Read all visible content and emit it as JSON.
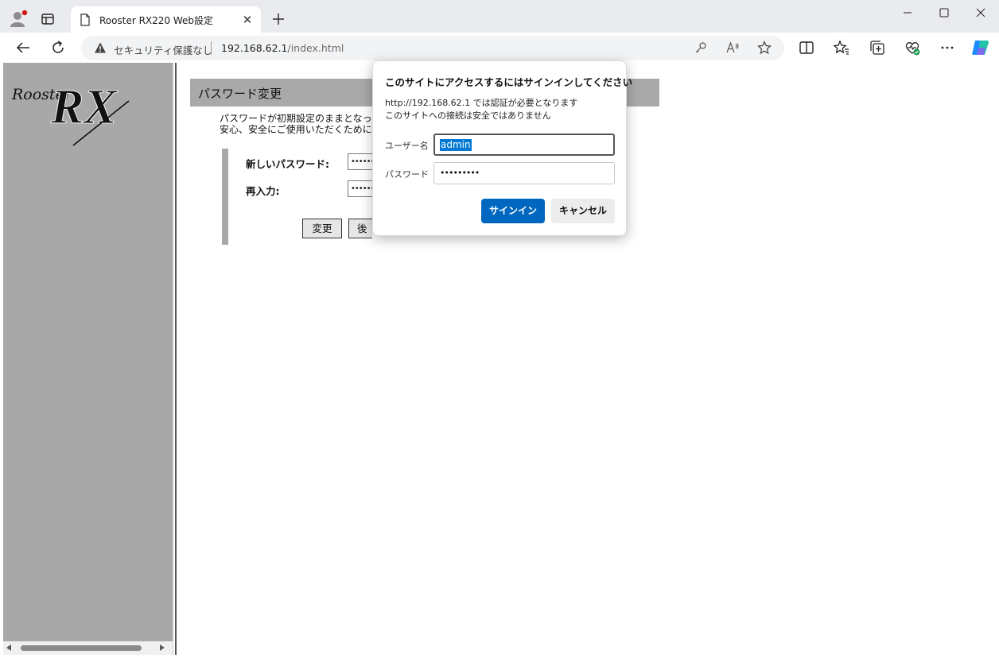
{
  "browser": {
    "tab_title": "Rooster RX220 Web設定",
    "tab_close": "✕",
    "security_label": "セキュリティ保護なし",
    "url_host": "192.168.62.1",
    "url_path": "/index.html",
    "icons": [
      "profile-icon",
      "tab-actions-icon",
      "page-icon",
      "new-tab-icon",
      "back-icon",
      "refresh-icon",
      "warning-icon",
      "key-icon",
      "read-aloud-icon",
      "favorite-star-icon",
      "split-screen-icon",
      "favorites-icon",
      "collections-icon",
      "browser-essentials-icon",
      "more-icon",
      "copilot-icon",
      "minimize-icon",
      "maximize-icon",
      "close-icon"
    ]
  },
  "page": {
    "logo_brand": "Rooster",
    "logo_mark": "RX",
    "heading": "パスワード変更",
    "desc_line1": "パスワードが初期設定のままとなっています。",
    "desc_line2": "安心、安全にご使用いただくために、変更してください。",
    "new_password_label": "新しいパスワード:",
    "reenter_label": "再入力:",
    "password_mask": "••••••",
    "change_button": "変更",
    "later_button": "後で"
  },
  "dialog": {
    "title": "このサイトにアクセスするにはサインインしてください",
    "message1": "http://192.168.62.1 では認証が必要となります",
    "message2": "このサイトへの接続は安全ではありません",
    "username_label": "ユーザー名",
    "username_value": "admin",
    "password_label": "パスワード",
    "password_value": "•••••••••",
    "signin_button": "サインイン",
    "cancel_button": "キャンセル"
  }
}
